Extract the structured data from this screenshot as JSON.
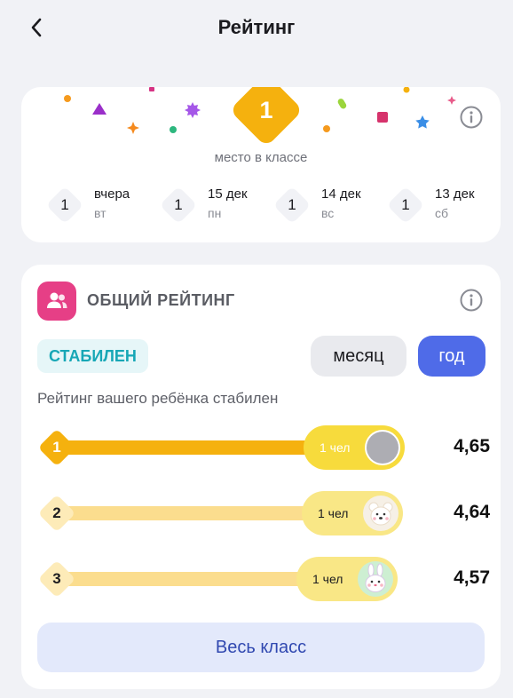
{
  "header": {
    "title": "Рейтинг",
    "back_icon": "chevron-left-icon"
  },
  "summary": {
    "place": "1",
    "place_label": "место в классе",
    "info_icon": "info-icon",
    "days": [
      {
        "rank": "1",
        "date": "вчера",
        "weekday": "вт"
      },
      {
        "rank": "1",
        "date": "15 дек",
        "weekday": "пн"
      },
      {
        "rank": "1",
        "date": "14 дек",
        "weekday": "вс"
      },
      {
        "rank": "1",
        "date": "13 дек",
        "weekday": "сб"
      }
    ]
  },
  "overall": {
    "title": "ОБЩИЙ РЕЙТИНГ",
    "section_icon": "users-icon",
    "info_icon": "info-icon",
    "status": "СТАБИЛЕН",
    "period_month": "месяц",
    "period_year": "год",
    "selected_period": "год",
    "description": "Рейтинг вашего ребёнка стабилен",
    "ranks": [
      {
        "rank": "1",
        "count": "1 чел",
        "score": "4,65",
        "value": 4.65,
        "avatar": "gray-circle-avatar",
        "highlight": true
      },
      {
        "rank": "2",
        "count": "1 чел",
        "score": "4,64",
        "value": 4.64,
        "avatar": "bear-avatar",
        "highlight": false
      },
      {
        "rank": "3",
        "count": "1 чел",
        "score": "4,57",
        "value": 4.57,
        "avatar": "bunny-avatar",
        "highlight": false
      }
    ],
    "whole_class_button": "Весь класс"
  },
  "colors": {
    "accent_gold": "#F5B10E",
    "gold_light": "#FBDD8E",
    "pill_bright": "#F7DB3C",
    "pill_light": "#F9E786",
    "primary_blue": "#4F6BE8",
    "status_teal": "#17A7B6",
    "section_pink": "#E63F86"
  }
}
